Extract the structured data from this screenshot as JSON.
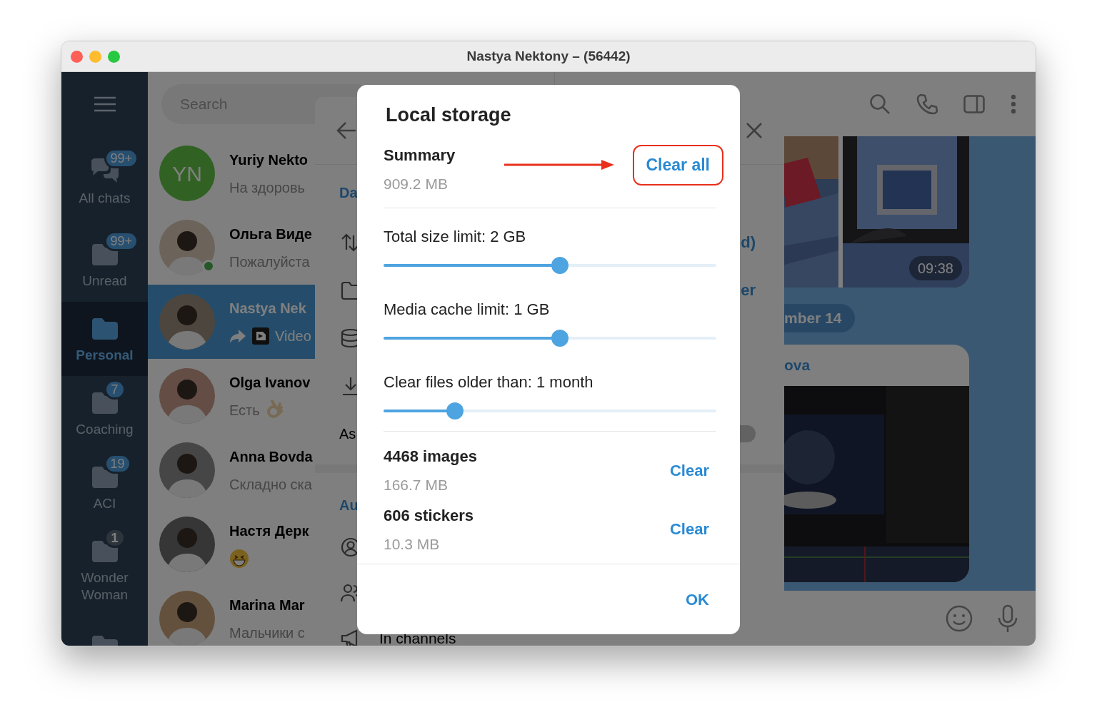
{
  "window": {
    "title": "Nastya Nektony – (56442)"
  },
  "folders": [
    {
      "label": "All chats",
      "kind": "chats",
      "badge": "99+",
      "muted": false,
      "selected": false
    },
    {
      "label": "Unread",
      "kind": "folder",
      "badge": "99+",
      "muted": false,
      "selected": false
    },
    {
      "label": "Personal",
      "kind": "folder",
      "selected": true
    },
    {
      "label": "Coaching",
      "kind": "folder",
      "badge": "7",
      "muted": false,
      "selected": false
    },
    {
      "label": "ACI",
      "kind": "folder",
      "badge": "19",
      "muted": false,
      "selected": false
    },
    {
      "label": "Wonder Woman",
      "kind": "folder",
      "badge": "1",
      "muted": true,
      "selected": false
    },
    {
      "kind": "folder",
      "selected": false
    }
  ],
  "search": {
    "placeholder": "Search"
  },
  "chats": [
    {
      "name": "Yuriy Nekto",
      "preview": "На здоровь",
      "initials": "YN",
      "selected": false
    },
    {
      "name": "Ольга Виде",
      "preview": "Пожалуйста",
      "online": true,
      "selected": false
    },
    {
      "name": "Nastya Nek",
      "preview": "Video",
      "forwarded": true,
      "selected": true
    },
    {
      "name": "Olga Ivanov",
      "preview": "Есть",
      "selected": false
    },
    {
      "name": "Anna Bovda",
      "preview": "Складно ска",
      "selected": false
    },
    {
      "name": "Настя Дерк",
      "selected": false
    },
    {
      "name": "Marina Mar",
      "preview": "Мальчики с",
      "selected": false
    }
  ],
  "chat": {
    "time": "09:38",
    "date": "mber 14",
    "sender": "ova"
  },
  "settings_panel": {
    "sections": [
      {
        "heading": "Da",
        "rows": [
          {
            "kind": "icon",
            "value": "d)"
          },
          {
            "kind": "icon",
            "value": "er"
          },
          {
            "kind": "icon"
          },
          {
            "kind": "icon"
          },
          {
            "kind": "toggle",
            "label": "As",
            "on": false
          }
        ]
      },
      {
        "heading": "Au",
        "rows": [
          {
            "kind": "icon"
          },
          {
            "kind": "icon"
          },
          {
            "kind": "icon",
            "label": "In channels"
          }
        ]
      }
    ]
  },
  "dialog": {
    "title": "Local storage",
    "summary": {
      "label": "Summary",
      "size": "909.2 MB",
      "button": "Clear all",
      "highlighted": true
    },
    "limits": [
      {
        "label": "Total size limit: 2 GB",
        "level": 0.53
      },
      {
        "label": "Media cache limit: 1 GB",
        "level": 0.53
      },
      {
        "label": "Clear files older than: 1 month",
        "level": 0.215
      }
    ],
    "items": [
      {
        "title": "4468 images",
        "size": "166.7 MB",
        "button": "Clear"
      },
      {
        "title": "606 stickers",
        "size": "10.3 MB",
        "button": "Clear"
      }
    ],
    "ok": "OK"
  }
}
